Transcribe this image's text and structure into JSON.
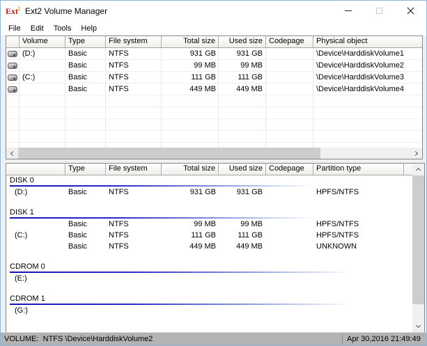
{
  "window": {
    "title": "Ext2 Volume Manager",
    "app_icon": {
      "text": "Ext",
      "sup": "2"
    },
    "controls": {
      "minimize": "minimize",
      "maximize": "maximize-disabled",
      "close": "close"
    }
  },
  "menu": {
    "items": [
      "File",
      "Edit",
      "Tools",
      "Help"
    ]
  },
  "volume_list": {
    "columns": [
      "",
      "Volume",
      "Type",
      "File system",
      "Total size",
      "Used size",
      "Codepage",
      "Physical object"
    ],
    "rows": [
      {
        "volume": "(D:)",
        "type": "Basic",
        "fs": "NTFS",
        "total": "931 GB",
        "used": "931 GB",
        "codepage": "",
        "physical": "\\Device\\HarddiskVolume1"
      },
      {
        "volume": "",
        "type": "Basic",
        "fs": "NTFS",
        "total": "99 MB",
        "used": "99 MB",
        "codepage": "",
        "physical": "\\Device\\HarddiskVolume2"
      },
      {
        "volume": "(C:)",
        "type": "Basic",
        "fs": "NTFS",
        "total": "111 GB",
        "used": "111 GB",
        "codepage": "",
        "physical": "\\Device\\HarddiskVolume3"
      },
      {
        "volume": "",
        "type": "Basic",
        "fs": "NTFS",
        "total": "449 MB",
        "used": "449 MB",
        "codepage": "",
        "physical": "\\Device\\HarddiskVolume4"
      }
    ]
  },
  "disk_tree": {
    "columns": [
      "",
      "Type",
      "File system",
      "Total size",
      "Used size",
      "Codepage",
      "Partition type"
    ],
    "sections": [
      {
        "label": "DISK 0",
        "line": "disk",
        "entries": [
          {
            "volume": "(D:)",
            "type": "Basic",
            "fs": "NTFS",
            "total": "931 GB",
            "used": "931 GB",
            "codepage": "",
            "partition": "HPFS/NTFS"
          }
        ]
      },
      {
        "label": "DISK 1",
        "line": "disk",
        "entries": [
          {
            "volume": "",
            "type": "Basic",
            "fs": "NTFS",
            "total": "99 MB",
            "used": "99 MB",
            "codepage": "",
            "partition": "HPFS/NTFS"
          },
          {
            "volume": "(C:)",
            "type": "Basic",
            "fs": "NTFS",
            "total": "111 GB",
            "used": "111 GB",
            "codepage": "",
            "partition": "HPFS/NTFS"
          },
          {
            "volume": "",
            "type": "Basic",
            "fs": "NTFS",
            "total": "449 MB",
            "used": "449 MB",
            "codepage": "",
            "partition": "UNKNOWN"
          }
        ]
      },
      {
        "label": "CDROM 0",
        "line": "cdrom",
        "entries": [
          {
            "volume": "(E:)",
            "type": "",
            "fs": "",
            "total": "",
            "used": "",
            "codepage": "",
            "partition": ""
          }
        ]
      },
      {
        "label": "CDROM 1",
        "line": "cdrom",
        "entries": [
          {
            "volume": "(G:)",
            "type": "",
            "fs": "",
            "total": "",
            "used": "",
            "codepage": "",
            "partition": ""
          }
        ]
      }
    ]
  },
  "statusbar": {
    "left": "VOLUME:  NTFS \\Device\\HarddiskVolume2",
    "right": "Apr 30,2016 21:49:49"
  },
  "icons": {
    "app": "ext2-logo",
    "row": "disk-drive-icon",
    "scroll": [
      "chevron-left-icon",
      "chevron-right-icon",
      "chevron-up-icon",
      "chevron-down-icon"
    ]
  },
  "colors": {
    "window_border": "#8fb6d9",
    "section_line_blue": "#1414b4",
    "status_bar_bg": "#b3b3b3",
    "scrollbar_thumb": "#cdcdcd"
  }
}
